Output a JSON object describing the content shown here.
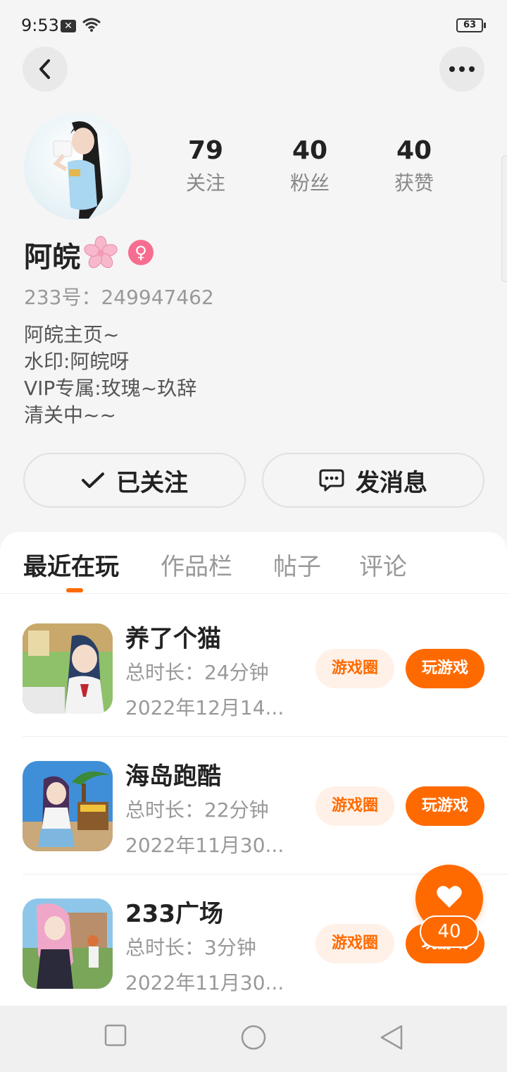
{
  "status_bar": {
    "time": "9:53",
    "battery": "63"
  },
  "profile": {
    "nickname": "阿皖",
    "uid": "233号：249947462",
    "bio": [
      "阿皖主页~",
      "水印:阿皖呀",
      "VIP专属:玫瑰~玖辞",
      "清关中~~"
    ],
    "gender_symbol": "♀",
    "stats": [
      {
        "value": "79",
        "label": "关注"
      },
      {
        "value": "40",
        "label": "粉丝"
      },
      {
        "value": "40",
        "label": "获赞"
      }
    ]
  },
  "actions": {
    "follow_label": "已关注",
    "message_label": "发消息"
  },
  "tabs": [
    {
      "label": "最近在玩",
      "active": true
    },
    {
      "label": "作品栏",
      "active": false
    },
    {
      "label": "帖子",
      "active": false
    },
    {
      "label": "评论",
      "active": false
    }
  ],
  "games": [
    {
      "name": "养了个猫",
      "playtime": "总时长：24分钟",
      "date": "2022年12月14...",
      "circle_label": "游戏圈",
      "play_label": "玩游戏"
    },
    {
      "name": "海岛跑酷",
      "playtime": "总时长：22分钟",
      "date": "2022年11月30...",
      "circle_label": "游戏圈",
      "play_label": "玩游戏"
    },
    {
      "name": "233广场",
      "playtime": "总时长：3分钟",
      "date": "2022年11月30...",
      "circle_label": "游戏圈",
      "play_label": "玩游戏"
    }
  ],
  "like_fab": {
    "count": "40"
  },
  "colors": {
    "accent": "#ff6a00",
    "chip_bg": "#fff1e8",
    "gender": "#f76d8f"
  },
  "icons": [
    "back-arrow-icon",
    "more-dots-icon",
    "wifi-icon",
    "checkmark-icon",
    "chat-bubble-icon",
    "heart-icon",
    "sakura-icon",
    "nav-recents-icon",
    "nav-home-icon",
    "nav-back-icon"
  ]
}
